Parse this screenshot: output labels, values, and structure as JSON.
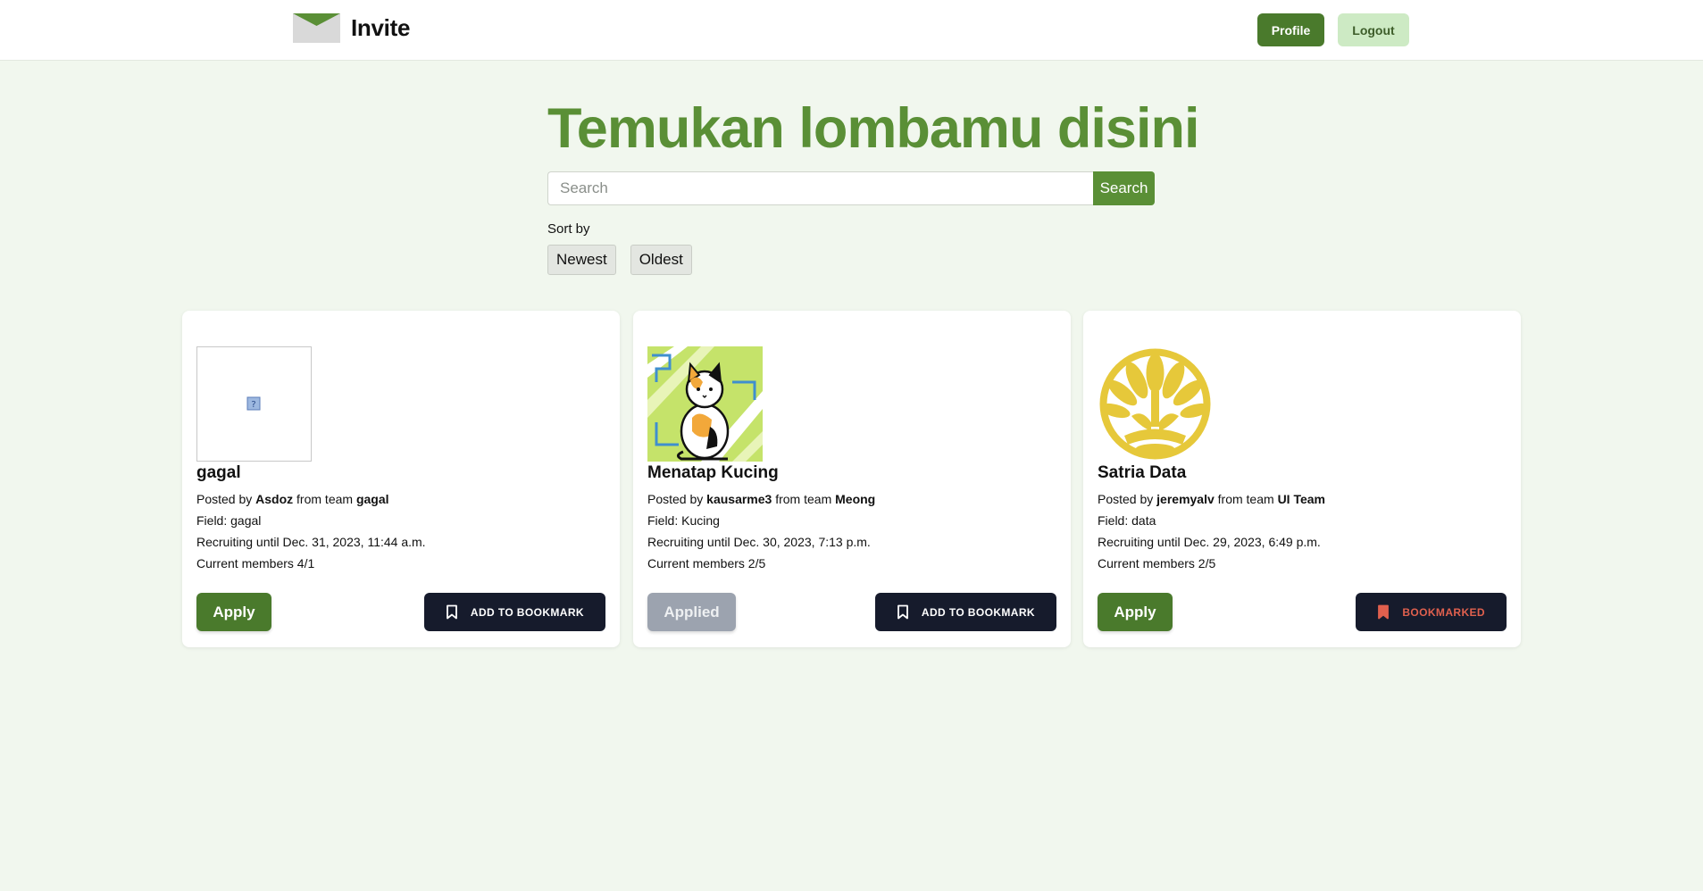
{
  "navbar": {
    "brand_title": "Invite",
    "logo_icon": "envelope-icon",
    "profile_label": "Profile",
    "logout_label": "Logout"
  },
  "hero": {
    "title": "Temukan lombamu disini"
  },
  "search": {
    "placeholder": "Search",
    "value": "",
    "button_label": "Search"
  },
  "sort": {
    "label": "Sort by",
    "options": [
      "Newest",
      "Oldest"
    ]
  },
  "colors": {
    "primary_green": "#4a7a2c",
    "title_green": "#5a8f36",
    "light_green": "#cdeac4",
    "background": "#f1f7ee",
    "dark_button": "#161b2c",
    "bookmarked_red": "#e0604e",
    "disabled_gray": "#9ca3af"
  },
  "cards": [
    {
      "image": "broken-image-icon",
      "name": "gagal",
      "posted_by_prefix": "Posted by",
      "author": "Asdoz",
      "team_prefix": "from team",
      "team": "gagal",
      "field": "Field: gagal",
      "recruiting": "Recruiting until Dec. 31, 2023, 11:44 a.m.",
      "members": "Current members 4/1",
      "apply_label": "Apply",
      "apply_state": "active",
      "bookmark_label": "ADD TO BOOKMARK",
      "bookmark_icon": "bookmark-outline-icon"
    },
    {
      "image": "cat-illustration",
      "name": "Menatap Kucing",
      "posted_by_prefix": "Posted by",
      "author": "kausarme3",
      "team_prefix": "from team",
      "team": "Meong",
      "field": "Field: Kucing",
      "recruiting": "Recruiting until Dec. 30, 2023, 7:13 p.m.",
      "members": "Current members 2/5",
      "apply_label": "Applied",
      "apply_state": "disabled",
      "bookmark_label": "ADD TO BOOKMARK",
      "bookmark_icon": "bookmark-outline-icon"
    },
    {
      "image": "university-emblem",
      "name": "Satria Data",
      "posted_by_prefix": "Posted by",
      "author": "jeremyalv",
      "team_prefix": "from team",
      "team": "UI Team",
      "field": "Field: data",
      "recruiting": "Recruiting until Dec. 29, 2023, 6:49 p.m.",
      "members": "Current members 2/5",
      "apply_label": "Apply",
      "apply_state": "active",
      "bookmark_label": "BOOKMARKED",
      "bookmark_icon": "bookmark-filled-icon"
    }
  ]
}
